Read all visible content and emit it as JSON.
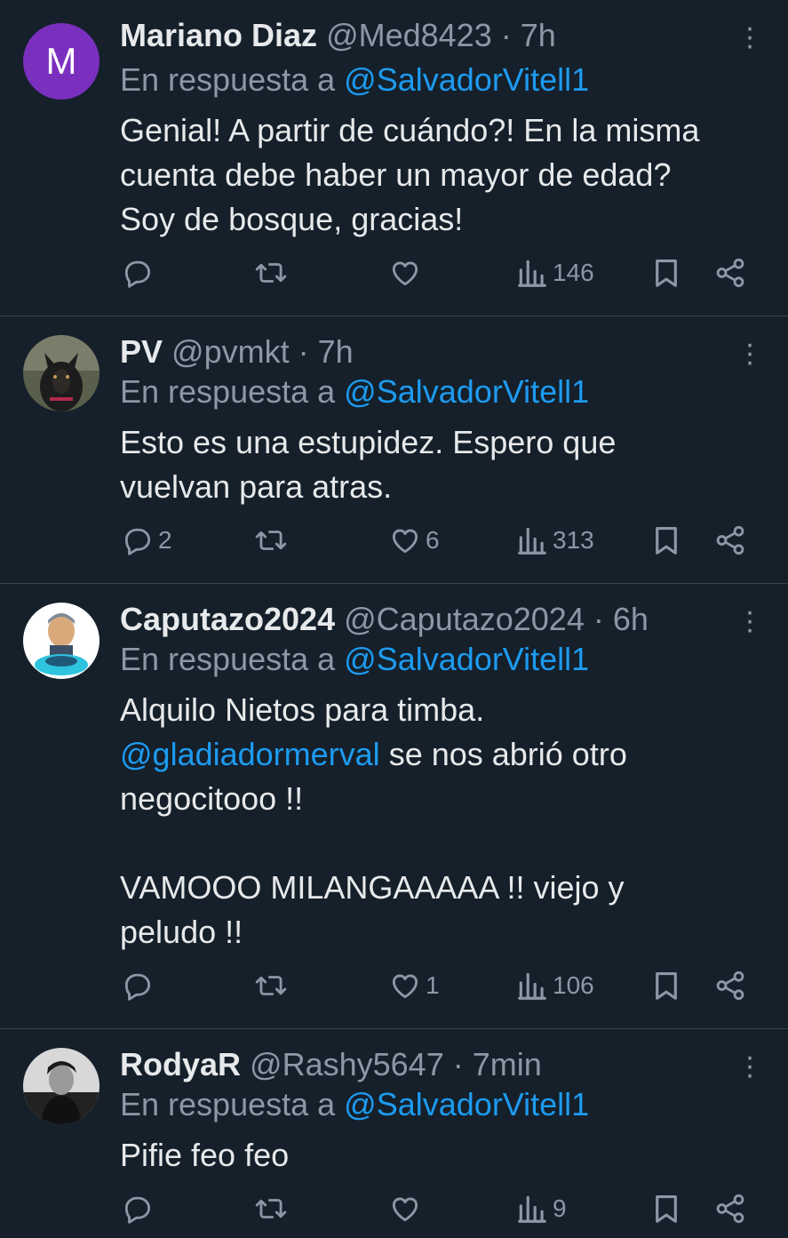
{
  "tweets": [
    {
      "avatar_letter": "M",
      "name": "Mariano Diaz",
      "handle": "@Med8423",
      "time": "7h",
      "reply_prefix": "En respuesta a",
      "reply_to": "@SalvadorVitell1",
      "lines": [
        "Genial! A partir de cuándo?! En la misma",
        "cuenta debe haber un mayor de edad?",
        "Soy de bosque, gracias!"
      ],
      "replies": "",
      "retweets": "",
      "likes": "",
      "views": "146"
    },
    {
      "name": "PV",
      "handle": "@pvmkt",
      "time": "7h",
      "reply_prefix": "En respuesta a",
      "reply_to": "@SalvadorVitell1",
      "lines": [
        "Esto es una estupidez. Espero que",
        "vuelvan para atras."
      ],
      "replies": "2",
      "retweets": "",
      "likes": "6",
      "views": "313"
    },
    {
      "name": "Caputazo2024",
      "handle": "@Caputazo2024",
      "time": "6h",
      "reply_prefix": "En respuesta a",
      "reply_to": "@SalvadorVitell1",
      "line1": "Alquilo Nietos para timba.",
      "line2_mention": "@gladiadormerval",
      "line2_rest": " se nos abrió otro",
      "line3": "negocitooo !!",
      "line4": "VAMOOO MILANGAAAAA !! viejo y",
      "line5": "peludo !!",
      "replies": "",
      "retweets": "",
      "likes": "1",
      "views": "106"
    },
    {
      "name": "RodyaR",
      "handle": "@Rashy5647",
      "time": "7min",
      "reply_prefix": "En respuesta a",
      "reply_to": "@SalvadorVitell1",
      "lines": [
        "Pifie feo feo"
      ],
      "replies": "",
      "retweets": "",
      "likes": "",
      "views": "9"
    }
  ],
  "separator": "·",
  "colors": {
    "background": "#15202b",
    "mention": "#1d9bf0",
    "muted": "#8b98a5"
  }
}
